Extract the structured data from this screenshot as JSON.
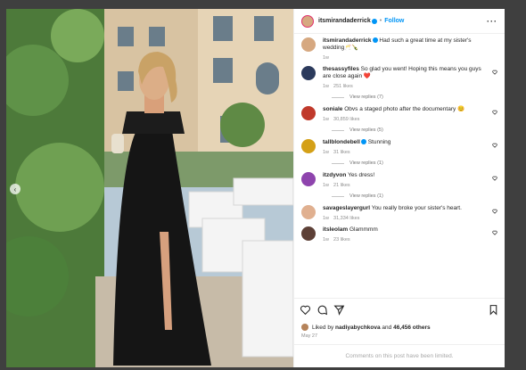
{
  "post": {
    "author": "itsmirandaderrick",
    "follow_label": "Follow",
    "caption": "Had such a great time at my sister's wedding🥂🍾",
    "caption_age": "1w"
  },
  "comments": [
    {
      "user": "thesassyfiles",
      "text": "So glad you went! Hoping this means you guys are close again ❤️",
      "age": "1w",
      "likes": "251 likes",
      "replies": "View replies (7)",
      "avatar_color": "#2b3a5c"
    },
    {
      "user": "soniale",
      "text": "Obvs a staged photo after the documentary 😊",
      "age": "1w",
      "likes": "30,859 likes",
      "replies": "View replies (5)",
      "avatar_color": "#c0392b"
    },
    {
      "user": "tallblondebell",
      "verified": true,
      "text": "Stunning",
      "age": "1w",
      "likes": "31 likes",
      "replies": "View replies (1)",
      "avatar_color": "#d4a017"
    },
    {
      "user": "itzdyvon",
      "text": "Yes dress!",
      "age": "1w",
      "likes": "21 likes",
      "replies": "View replies (1)",
      "avatar_color": "#8e44ad"
    },
    {
      "user": "savageslayergurl",
      "text": "You really broke your sister's heart.",
      "age": "1w",
      "likes": "31,334 likes",
      "avatar_color": "#e0b090"
    },
    {
      "user": "itsleolam",
      "text": "Glammmm",
      "age": "1w",
      "likes": "23 likes",
      "avatar_color": "#5d4037"
    }
  ],
  "likes_text_prefix": "Liked by ",
  "likes_user": "nadiyabychkova",
  "likes_and": " and ",
  "likes_count": "46,456 others",
  "post_date": "May 27",
  "comments_limited": "Comments on this post have been limited.",
  "icons": {
    "more": "more-options-icon",
    "heart": "heart-icon",
    "comment": "comment-icon",
    "share": "share-icon",
    "save": "bookmark-icon"
  },
  "colors": {
    "accent": "#0095f6",
    "modal_backdrop": "#3f3f3f"
  }
}
